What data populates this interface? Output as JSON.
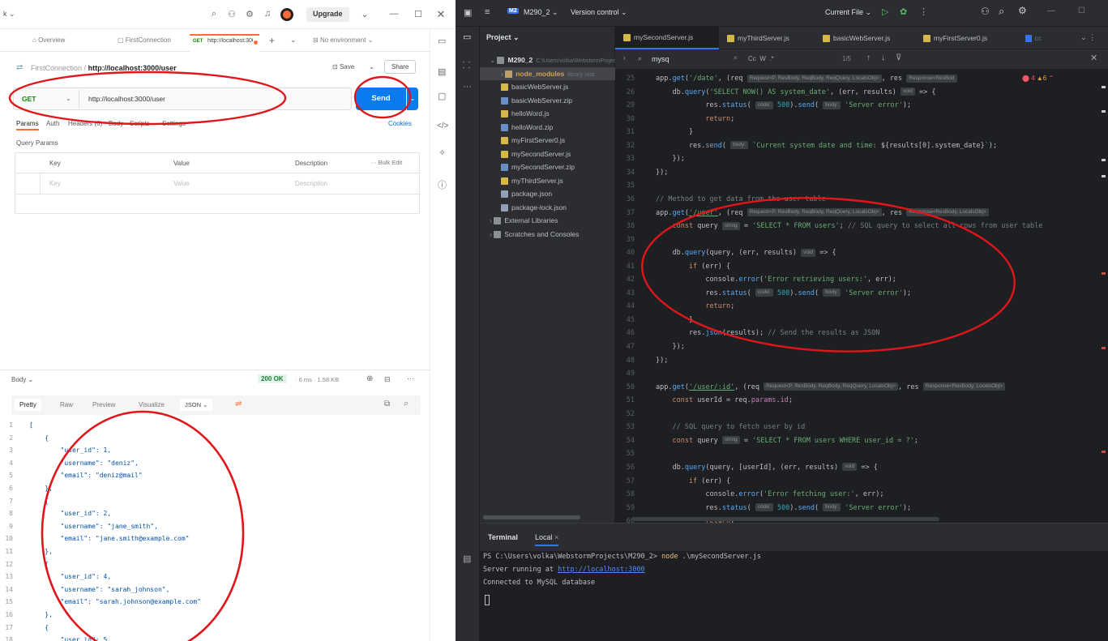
{
  "postman": {
    "top": {
      "upgrade_label": "Upgrade",
      "workspace_fragment": "k"
    },
    "tabs": [
      {
        "label": "Overview"
      },
      {
        "label": "FirstConnection"
      },
      {
        "method": "GET",
        "label": "http://localhost:300("
      }
    ],
    "environment": "No environment",
    "breadcrumb": {
      "collection": "FirstConnection",
      "separator": "/",
      "request": "http://localhost:3000/user"
    },
    "save_label": "Save",
    "share_label": "Share",
    "request": {
      "method": "GET",
      "url": "http://localhost:3000/user",
      "send_label": "Send"
    },
    "subtabs": [
      "Params",
      "Auth",
      "Headers (6)",
      "Body",
      "Scripts",
      "Settings"
    ],
    "cookies_label": "Cookies",
    "query_params_label": "Query Params",
    "params_table": {
      "headers": [
        "Key",
        "Value",
        "Description"
      ],
      "bulk_edit": "Bulk Edit",
      "placeholders": [
        "Key",
        "Value",
        "Description"
      ]
    },
    "response": {
      "body_label": "Body",
      "status": "200 OK",
      "time": "6 ms",
      "size": "1.58 KB",
      "view_tabs": [
        "Pretty",
        "Raw",
        "Preview",
        "Visualize"
      ],
      "format": "JSON",
      "lines": [
        {
          "n": "1",
          "t": "["
        },
        {
          "n": "2",
          "t": "    {"
        },
        {
          "n": "3",
          "t": "        \"user_id\": 1,"
        },
        {
          "n": "4",
          "t": "        \"username\": \"deniz\","
        },
        {
          "n": "5",
          "t": "        \"email\": \"deniz@mail\""
        },
        {
          "n": "6",
          "t": "    },"
        },
        {
          "n": "7",
          "t": "    {"
        },
        {
          "n": "8",
          "t": "        \"user_id\": 2,"
        },
        {
          "n": "9",
          "t": "        \"username\": \"jane_smith\","
        },
        {
          "n": "10",
          "t": "        \"email\": \"jane.smith@example.com\""
        },
        {
          "n": "11",
          "t": "    },"
        },
        {
          "n": "12",
          "t": "    {"
        },
        {
          "n": "13",
          "t": "        \"user_id\": 4,"
        },
        {
          "n": "14",
          "t": "        \"username\": \"sarah_johnson\","
        },
        {
          "n": "15",
          "t": "        \"email\": \"sarah.johnson@example.com\""
        },
        {
          "n": "16",
          "t": "    },"
        },
        {
          "n": "17",
          "t": "    {"
        },
        {
          "n": "18",
          "t": "        \"user_id\": 5,"
        },
        {
          "n": "19",
          "t": "        \"username\": \"chris_williams\","
        },
        {
          "n": "20",
          "t": "        \"email\": \"chris.williams@example.com\""
        }
      ]
    }
  },
  "ide": {
    "project_badge": "M2",
    "project_name": "M290_2",
    "version_control": "Version control",
    "current_file": "Current File",
    "project_label": "Project",
    "editor_tabs": [
      "mySecondServer.js",
      "myThirdServer.js",
      "basicWebServer.js",
      "myFirstServer0.js",
      "cc"
    ],
    "search": {
      "query": "mysq",
      "options": "Cc  W  .*",
      "count": "1/5"
    },
    "inspections": {
      "errors": "4",
      "warnings": "6"
    },
    "tree": [
      {
        "label": "M290_2",
        "extra": "C:\\Users\\volka\\WebstormProjects\\M290_2",
        "kind": "root"
      },
      {
        "label": "node_modules",
        "extra": "library root",
        "kind": "folder"
      },
      {
        "label": "basicWebServer.js",
        "kind": "js"
      },
      {
        "label": "basicWebServer.zip",
        "kind": "zip"
      },
      {
        "label": "helloWord.js",
        "kind": "js"
      },
      {
        "label": "helloWord.zip",
        "kind": "zip"
      },
      {
        "label": "myFirstServer0.js",
        "kind": "js"
      },
      {
        "label": "mySecondServer.js",
        "kind": "js"
      },
      {
        "label": "mySecondServer.zip",
        "kind": "zip"
      },
      {
        "label": "myThirdServer.js",
        "kind": "js"
      },
      {
        "label": "package.json",
        "kind": "json"
      },
      {
        "label": "package-lock.json",
        "kind": "json"
      },
      {
        "label": "External Libraries",
        "kind": "lib"
      },
      {
        "label": "Scratches and Consoles",
        "kind": "scratch"
      }
    ],
    "code": [
      {
        "n": "25",
        "segs": [
          [
            "iv",
            "app."
          ],
          [
            "if",
            "get"
          ],
          [
            "iv",
            "("
          ],
          [
            "is",
            "'/date'"
          ],
          [
            "iv",
            ", (req "
          ],
          [
            "hint",
            "Request<P, ResBody, ReqBody, ReqQuery, LocalsObj>"
          ],
          [
            "iv",
            ", res "
          ],
          [
            "hint",
            "Response<ResBod"
          ]
        ]
      },
      {
        "n": "26",
        "segs": [
          [
            "iv",
            "    db."
          ],
          [
            "if",
            "query"
          ],
          [
            "iv",
            "("
          ],
          [
            "is",
            "'SELECT NOW() AS system_date'"
          ],
          [
            "iv",
            ", (err, results) "
          ],
          [
            "hint",
            "void"
          ],
          [
            "iv",
            " => {"
          ]
        ]
      },
      {
        "n": "29",
        "segs": [
          [
            "iv",
            "            res."
          ],
          [
            "if",
            "status"
          ],
          [
            "iv",
            "( "
          ],
          [
            "hint",
            "code:"
          ],
          [
            "inm",
            " 500"
          ],
          [
            "iv",
            ")."
          ],
          [
            "if",
            "send"
          ],
          [
            "iv",
            "( "
          ],
          [
            "hint",
            "body:"
          ],
          [
            "is",
            " 'Server error'"
          ],
          [
            "iv",
            ");"
          ]
        ]
      },
      {
        "n": "30",
        "segs": [
          [
            "ik",
            "            return"
          ],
          [
            "iv",
            ";"
          ]
        ]
      },
      {
        "n": "31",
        "segs": [
          [
            "iv",
            "        }"
          ]
        ]
      },
      {
        "n": "32",
        "segs": [
          [
            "iv",
            "        res."
          ],
          [
            "if",
            "send"
          ],
          [
            "iv",
            "( "
          ],
          [
            "hint",
            "body:"
          ],
          [
            "is",
            " `Current system date and time: "
          ],
          [
            "iv",
            "${results[0].system_date}"
          ],
          [
            "is",
            "`"
          ],
          [
            "iv",
            ");"
          ]
        ]
      },
      {
        "n": "33",
        "segs": [
          [
            "iv",
            "    });"
          ]
        ]
      },
      {
        "n": "34",
        "segs": [
          [
            "iv",
            "});"
          ]
        ]
      },
      {
        "n": "35",
        "segs": []
      },
      {
        "n": "36",
        "segs": [
          [
            "ic2",
            "// Method to get data from the user table"
          ]
        ]
      },
      {
        "n": "37",
        "segs": [
          [
            "iv",
            "app."
          ],
          [
            "if",
            "get"
          ],
          [
            "iv",
            "("
          ],
          [
            "is",
            "'/user'"
          ],
          [
            "iv",
            ", (req "
          ],
          [
            "hint",
            "Request<P, ResBody, ReqBody, ReqQuery, LocalsObj>"
          ],
          [
            "iv",
            ", res "
          ],
          [
            "hint",
            "Response<ResBody, LocalsObj>"
          ]
        ]
      },
      {
        "n": "38",
        "segs": [
          [
            "ik",
            "    const "
          ],
          [
            "iv",
            "query "
          ],
          [
            "hint",
            "string"
          ],
          [
            "iv",
            " = "
          ],
          [
            "is",
            "'SELECT * FROM users'"
          ],
          [
            "iv",
            "; "
          ],
          [
            "ic2",
            "// SQL query to select all rows from user table"
          ]
        ]
      },
      {
        "n": "39",
        "segs": []
      },
      {
        "n": "40",
        "segs": [
          [
            "iv",
            "    db."
          ],
          [
            "if",
            "query"
          ],
          [
            "iv",
            "(query, (err, results) "
          ],
          [
            "hint",
            "void"
          ],
          [
            "iv",
            " => {"
          ]
        ]
      },
      {
        "n": "41",
        "segs": [
          [
            "ik",
            "        if "
          ],
          [
            "iv",
            "(err) {"
          ]
        ]
      },
      {
        "n": "42",
        "segs": [
          [
            "iv",
            "            console."
          ],
          [
            "if",
            "error"
          ],
          [
            "iv",
            "("
          ],
          [
            "is",
            "'Error retrieving users:'"
          ],
          [
            "iv",
            ", err);"
          ]
        ]
      },
      {
        "n": "43",
        "segs": [
          [
            "iv",
            "            res."
          ],
          [
            "if",
            "status"
          ],
          [
            "iv",
            "( "
          ],
          [
            "hint",
            "code:"
          ],
          [
            "inm",
            " 500"
          ],
          [
            "iv",
            ")."
          ],
          [
            "if",
            "send"
          ],
          [
            "iv",
            "( "
          ],
          [
            "hint",
            "body:"
          ],
          [
            "is",
            " 'Server error'"
          ],
          [
            "iv",
            ");"
          ]
        ]
      },
      {
        "n": "44",
        "segs": [
          [
            "ik",
            "            return"
          ],
          [
            "iv",
            ";"
          ]
        ]
      },
      {
        "n": "45",
        "segs": [
          [
            "iv",
            "        }"
          ]
        ]
      },
      {
        "n": "46",
        "segs": [
          [
            "iv",
            "        res."
          ],
          [
            "if",
            "json"
          ],
          [
            "iv",
            "(results); "
          ],
          [
            "ic2",
            "// Send the results as JSON"
          ]
        ]
      },
      {
        "n": "47",
        "segs": [
          [
            "iv",
            "    });"
          ]
        ]
      },
      {
        "n": "48",
        "segs": [
          [
            "iv",
            "});"
          ]
        ]
      },
      {
        "n": "49",
        "segs": []
      },
      {
        "n": "50",
        "segs": [
          [
            "iv",
            "app."
          ],
          [
            "if",
            "get"
          ],
          [
            "iv",
            "("
          ],
          [
            "is",
            "'/user/:id'"
          ],
          [
            "iv",
            ", (req "
          ],
          [
            "hint",
            "Request<P, ResBody, ReqBody, ReqQuery, LocalsObj>"
          ],
          [
            "iv",
            ", res "
          ],
          [
            "hint",
            "Response<ResBody, LocalsObj>"
          ]
        ]
      },
      {
        "n": "51",
        "segs": [
          [
            "ik",
            "    const "
          ],
          [
            "iv",
            "userId = req."
          ],
          [
            "im",
            "params"
          ],
          [
            "iv",
            "."
          ],
          [
            "im",
            "id"
          ],
          [
            "iv",
            ";"
          ]
        ]
      },
      {
        "n": "52",
        "segs": []
      },
      {
        "n": "53",
        "segs": [
          [
            "ic2",
            "    // SQL query to fetch user by id"
          ]
        ]
      },
      {
        "n": "54",
        "segs": [
          [
            "ik",
            "    const "
          ],
          [
            "iv",
            "query "
          ],
          [
            "hint",
            "string"
          ],
          [
            "iv",
            " = "
          ],
          [
            "is",
            "'SELECT * FROM users WHERE user_id = ?'"
          ],
          [
            "iv",
            ";"
          ]
        ]
      },
      {
        "n": "55",
        "segs": []
      },
      {
        "n": "56",
        "segs": [
          [
            "iv",
            "    db."
          ],
          [
            "if",
            "query"
          ],
          [
            "iv",
            "(query, [userId], (err, results) "
          ],
          [
            "hint",
            "void"
          ],
          [
            "iv",
            " => {"
          ]
        ]
      },
      {
        "n": "57",
        "segs": [
          [
            "ik",
            "        if "
          ],
          [
            "iv",
            "(err) {"
          ]
        ]
      },
      {
        "n": "58",
        "segs": [
          [
            "iv",
            "            console."
          ],
          [
            "if",
            "error"
          ],
          [
            "iv",
            "("
          ],
          [
            "is",
            "'Error fetching user:'"
          ],
          [
            "iv",
            ", err);"
          ]
        ]
      },
      {
        "n": "59",
        "segs": [
          [
            "iv",
            "            res."
          ],
          [
            "if",
            "status"
          ],
          [
            "iv",
            "( "
          ],
          [
            "hint",
            "code:"
          ],
          [
            "inm",
            " 500"
          ],
          [
            "iv",
            ")."
          ],
          [
            "if",
            "send"
          ],
          [
            "iv",
            "( "
          ],
          [
            "hint",
            "body:"
          ],
          [
            "is",
            " 'Server error'"
          ],
          [
            "iv",
            ");"
          ]
        ]
      },
      {
        "n": "60",
        "segs": [
          [
            "ik",
            "            return"
          ],
          [
            "iv",
            ";"
          ]
        ]
      },
      {
        "n": "61",
        "segs": [
          [
            "iv",
            "        }"
          ]
        ]
      }
    ],
    "terminal": {
      "tab_terminal": "Terminal",
      "tab_local": "Local",
      "lines": [
        {
          "prompt": "PS C:\\Users\\volka\\WebstormProjects\\M290_2> ",
          "cmd": "node",
          "rest": " .\\mySecondServer.js"
        },
        {
          "pre": "Server running at ",
          "link": "http://localhost:3000"
        },
        {
          "pre": "Connected to MySQL database"
        }
      ]
    }
  },
  "colors": {
    "postman_orange": "#ff6c37",
    "send_blue": "#097bed",
    "annotation_red": "#e0161b",
    "ide_bg": "#1e1f22",
    "status_green": "#1a7f37"
  }
}
